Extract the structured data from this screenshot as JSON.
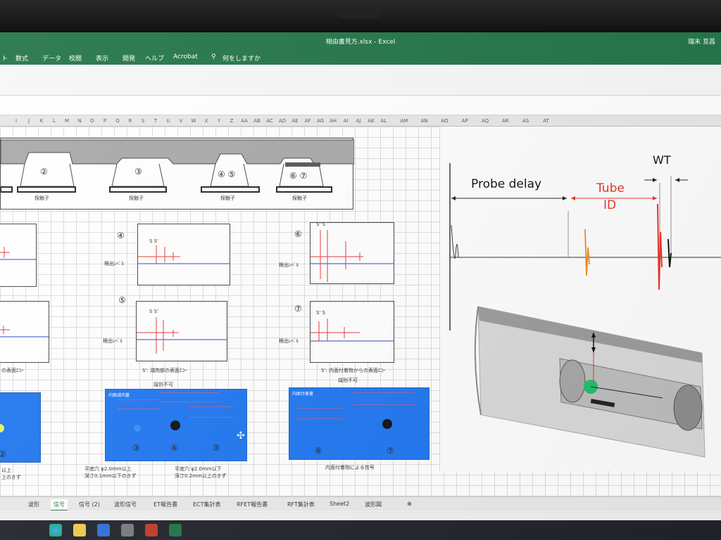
{
  "window": {
    "title": "相由書見方.xlsx - Excel",
    "user": "瑞末 亘昌"
  },
  "ribbon": {
    "tabs": [
      "ト",
      "数式",
      "データ",
      "校閲",
      "表示",
      "開発",
      "ヘルプ",
      "Acrobat"
    ],
    "tell_me": "何をしますか"
  },
  "columns": [
    "I",
    "J",
    "K",
    "L",
    "M",
    "N",
    "O",
    "P",
    "Q",
    "R",
    "S",
    "T",
    "U",
    "V",
    "W",
    "X",
    "Y",
    "Z",
    "AA",
    "AB",
    "AC",
    "AD",
    "AE",
    "AF",
    "AG",
    "AH",
    "AI",
    "AJ",
    "AK",
    "AL",
    "AM",
    "AN",
    "AO",
    "AP",
    "AQ",
    "AR",
    "AS",
    "AT"
  ],
  "diagram": {
    "probes": [
      "②",
      "③",
      "④ ⑤",
      "⑥ ⑦"
    ],
    "probe_label": "探触子"
  },
  "scopes": {
    "s4": {
      "num": "④",
      "marks": "S  S'",
      "level": "検出ﾚﾍﾞﾙ"
    },
    "s5": {
      "num": "⑤",
      "marks": "S  S'",
      "level": "検出ﾚﾍﾞﾙ",
      "caption": "S': 減肉部の表面ｴｺｰ"
    },
    "s6": {
      "num": "⑥",
      "marks": "S' S",
      "level": "検出ﾚﾍﾞﾙ"
    },
    "s7": {
      "num": "⑦",
      "marks": "S' S",
      "level": "検出ﾚﾍﾞﾙ",
      "caption": "S': 内面付着物からの表面ｴｺｰ"
    },
    "left_caption": "の表面ｴｺｰ"
  },
  "blue_panels": {
    "mid_title": "識別不可",
    "right_title": "識別不可",
    "mid_header": "内面減肉量",
    "right_header": "内面付着量",
    "mid_nums": [
      "③",
      "④",
      "⑤"
    ],
    "right_nums": [
      "⑥",
      "⑦"
    ],
    "left_num": "②",
    "mid_caption_a": "平底穴 φ2.0mm以上",
    "mid_caption_a2": "深さ0.1mm以下のきず",
    "mid_caption_b": "平底穴 φ2.0mm以下",
    "mid_caption_b2": "深さ0.2mm以上のきず",
    "left_caption_a": "以上",
    "left_caption_b": "上のきず",
    "right_caption": "内面付着物による信号"
  },
  "image_panel": {
    "wt": "WT",
    "probe_delay": "Probe delay",
    "tube": "Tube",
    "id": "ID"
  },
  "sheet_tabs": [
    "波形",
    "信号",
    "信号 (2)",
    "波形信号",
    "ET報告書",
    "ECT集計表",
    "RFET報告書",
    "RFT集計表",
    "Sheet2",
    "波形図"
  ],
  "active_tab": "信号",
  "colors": {
    "excel_green": "#217346",
    "panel_blue": "#1f76f0",
    "tube_red": "#e8322a",
    "echo_orange": "#f08a1c"
  }
}
